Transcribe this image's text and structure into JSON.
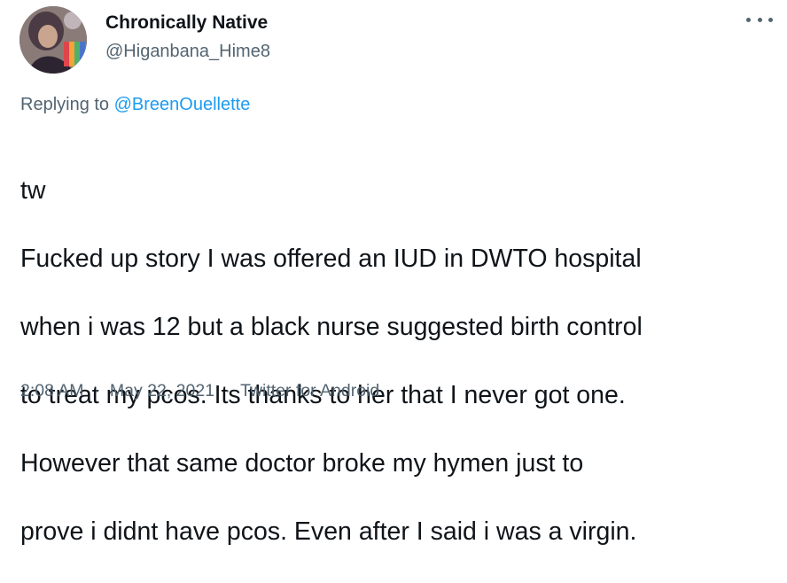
{
  "tweet": {
    "author": {
      "display_name": "Chronically Native",
      "handle": "@Higanbana_Hime8"
    },
    "replying_prefix": "Replying to",
    "replying_to": "@BreenOuellette",
    "body_lines": [
      "tw",
      "Fucked up story I was offered an IUD in DWTO hospital",
      "when i was 12 but a black nurse suggested birth control",
      "to treat my pcos. Its thanks to her that I never got one.",
      "However that same doctor broke my hymen just to",
      "prove i didnt have pcos. Even after I said i was a virgin."
    ],
    "time": "2:08 AM",
    "date": "May 22, 2021",
    "source": "Twitter for Android",
    "separator": "·"
  },
  "icons": {
    "more": "more-options-icon"
  },
  "colors": {
    "text_primary": "#0f1419",
    "text_secondary": "#536471",
    "link": "#1d9bf0"
  }
}
